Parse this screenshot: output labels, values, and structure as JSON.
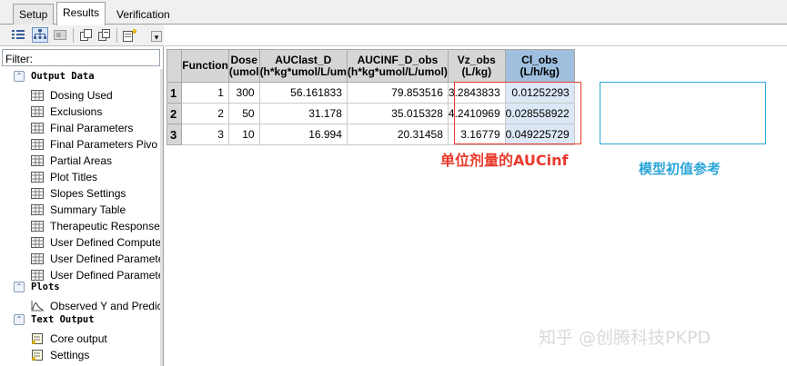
{
  "tabs": [
    "Setup",
    "Results",
    "Verification"
  ],
  "active_tab": "Results",
  "filter": {
    "label": "Filter:"
  },
  "sections": [
    {
      "title": "Output Data",
      "items": [
        "Dosing Used",
        "Exclusions",
        "Final Parameters",
        "Final Parameters Pivo",
        "Partial Areas",
        "Plot Titles",
        "Slopes Settings",
        "Summary Table",
        "Therapeutic Response",
        "User Defined Compute",
        "User Defined Paramete",
        "User Defined Paramete"
      ]
    },
    {
      "title": "Plots",
      "items": [
        "Observed Y and Predic"
      ]
    },
    {
      "title": "Text Output",
      "items": [
        "Core output",
        "Settings"
      ]
    }
  ],
  "table": {
    "columns": [
      "Function",
      "Dose\n(umol",
      "AUClast_D\n(h*kg*umol/L/um",
      "AUCINF_D_obs\n(h*kg*umol/L/umol)",
      "Vz_obs\n(L/kg)",
      "Cl_obs\n(L/h/kg)"
    ],
    "rows": [
      [
        "1",
        "1",
        "300",
        "56.161833",
        "79.853516",
        "3.2843833",
        "0.01252293"
      ],
      [
        "2",
        "2",
        "50",
        "31.178",
        "35.015328",
        "4.2410969",
        "0.028558922"
      ],
      [
        "3",
        "3",
        "10",
        "16.994",
        "20.31458",
        "3.16779",
        "0.049225729"
      ]
    ]
  },
  "annotations": {
    "red_label": "单位剂量的AUCinf",
    "blue_label": "模型初值参考",
    "red_color": "#e83a2c",
    "blue_color": "#2ea6d8"
  },
  "watermark": "知乎 @创腾科技PKPD"
}
